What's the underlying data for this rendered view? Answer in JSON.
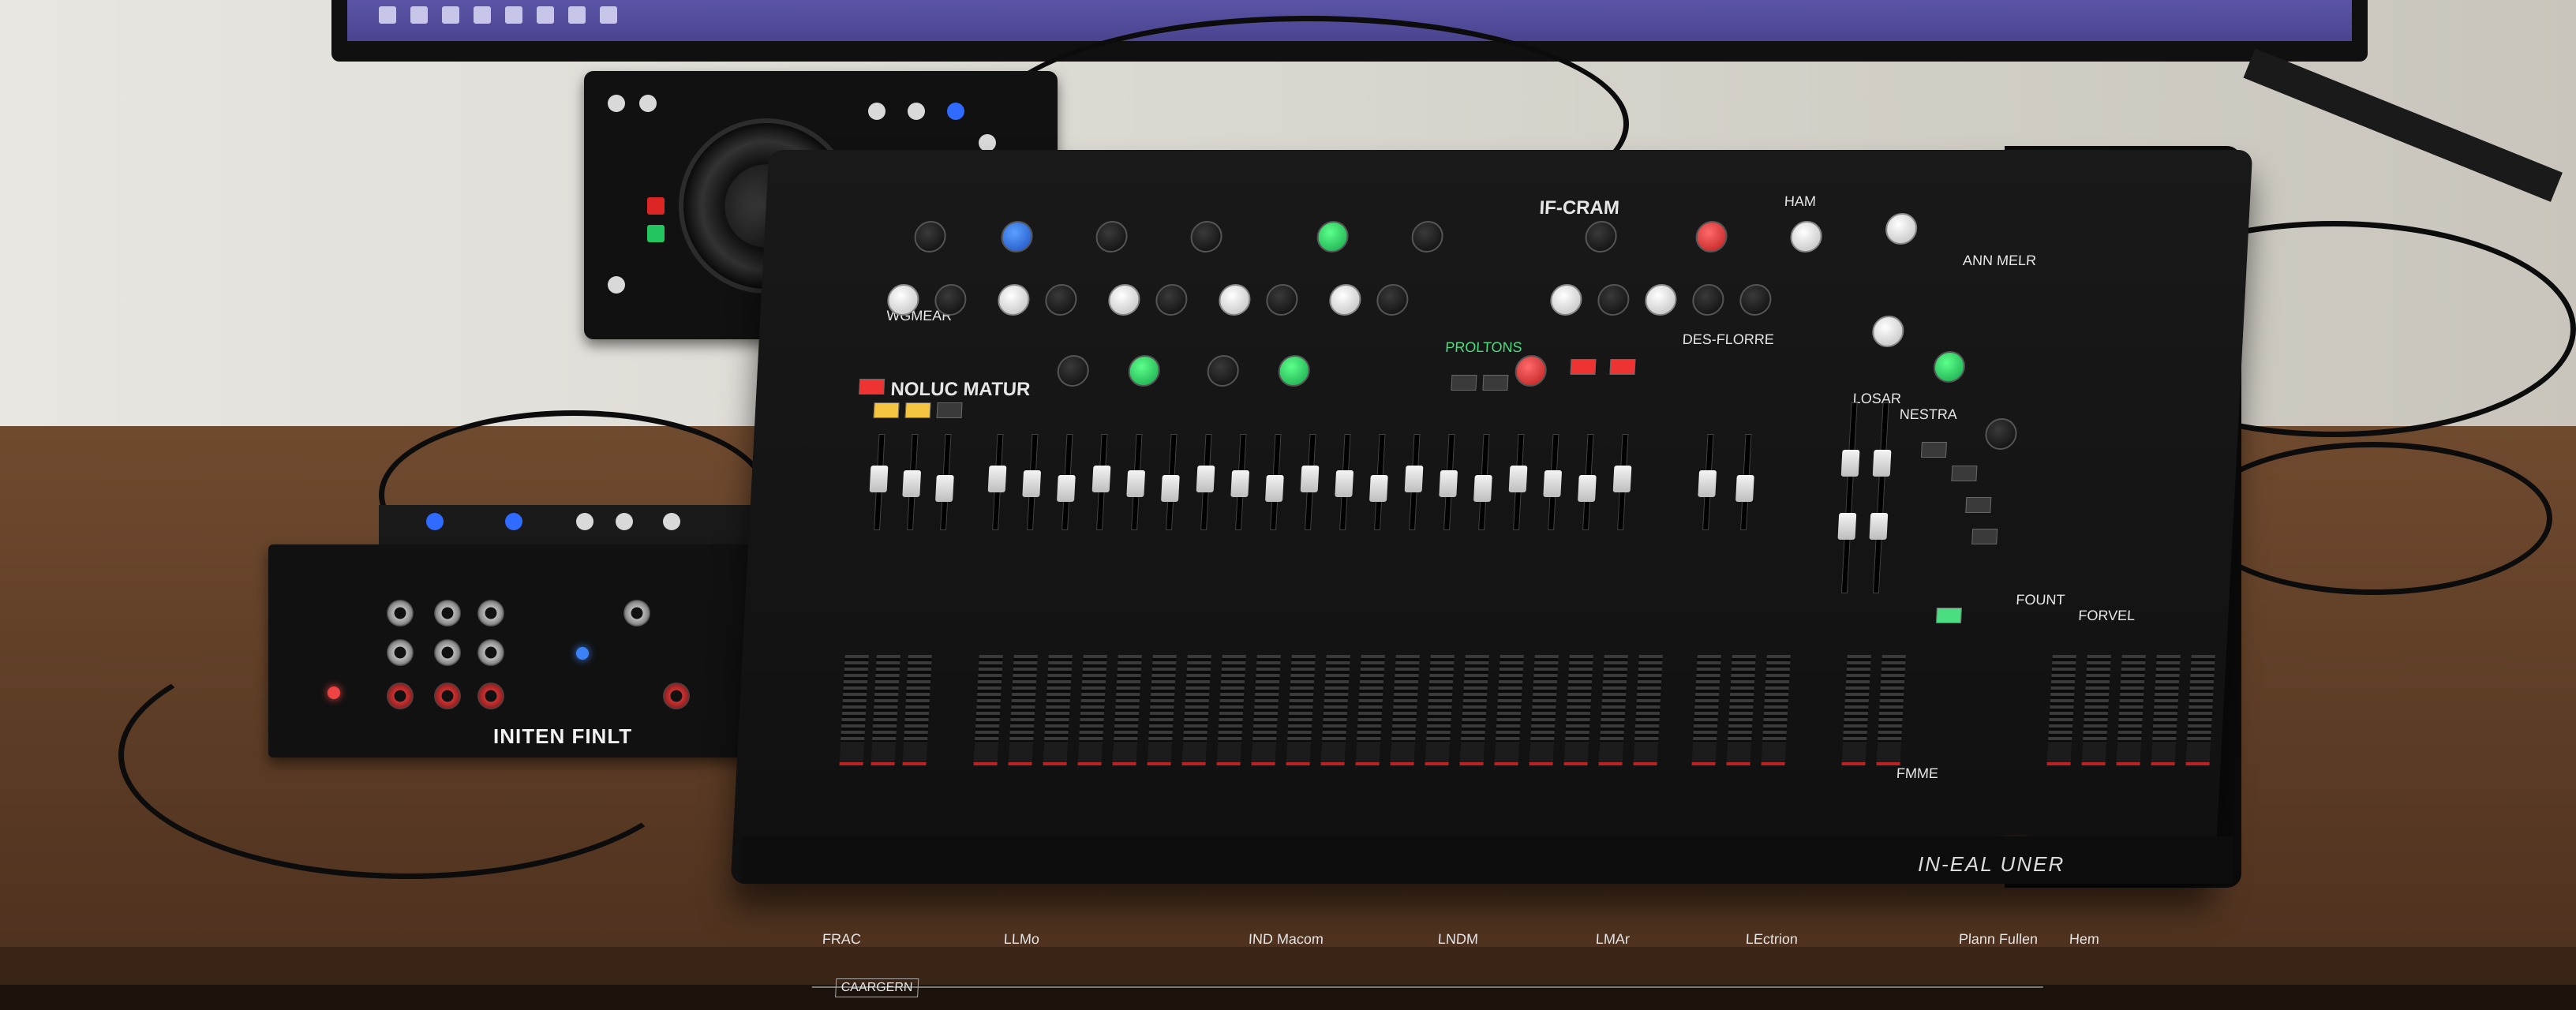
{
  "scene": {
    "description_labels": {
      "interface_label": "INITEN FINLT",
      "mixer_brand_bottom": "IN-EAL UNER",
      "mixer_logo_button": "CAARGERN"
    },
    "mixer_top_labels": {
      "section_a": "WGMEAR",
      "section_b": "NOLUC MATUR",
      "section_c": "IF-CRAM",
      "section_d": "ANN MELR",
      "section_e": "HAM",
      "section_f": "DES-FLORRE",
      "section_g": "LOSAR",
      "section_h": "NESTRA",
      "section_i": "PROLTONS"
    },
    "mixer_bottom_labels": {
      "group_1": "FRAC",
      "group_2": "LLMo",
      "group_3": "IND Macom",
      "group_4": "LNDM",
      "group_5": "LMAr",
      "group_6": "LEctrion",
      "group_7": "FMME",
      "group_8": "FOUNT",
      "group_9": "FORVEL",
      "group_10": "Plann Fullen",
      "group_11": "Hem"
    },
    "colors": {
      "desk": "#5a3a24",
      "mixer": "#141414",
      "wall": "#e3e1db",
      "monitor_screen": "#524c9c",
      "accent_blue": "#2f6bff",
      "accent_green": "#22c55e",
      "accent_red": "#dc2626",
      "accent_yellow": "#f5c542"
    },
    "icons": [
      "knob-icon",
      "fader-icon",
      "jack-icon",
      "jog-wheel-icon",
      "led-icon"
    ]
  }
}
